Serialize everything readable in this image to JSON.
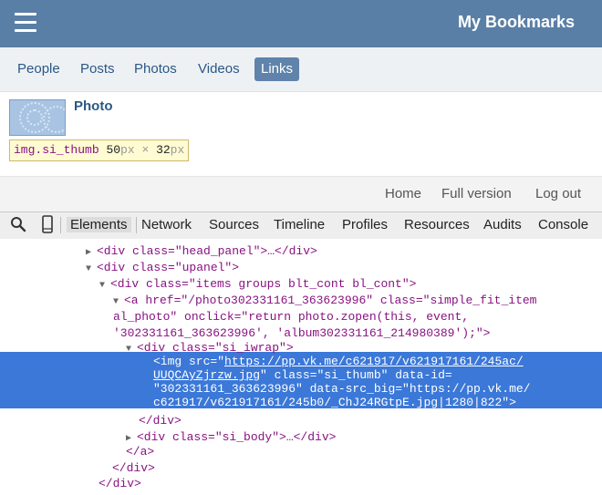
{
  "header": {
    "title": "My Bookmarks",
    "menu_icon": "hamburger-menu-icon"
  },
  "tabs": [
    {
      "label": "People",
      "active": false
    },
    {
      "label": "Posts",
      "active": false
    },
    {
      "label": "Photos",
      "active": false
    },
    {
      "label": "Videos",
      "active": false
    },
    {
      "label": "Links",
      "active": true
    }
  ],
  "content": {
    "item_title": "Photo",
    "tooltip": {
      "selector": "img.si_thumb",
      "width": "50",
      "unit1": "px",
      "times": " × ",
      "height": "32",
      "unit2": "px"
    }
  },
  "footer_links": [
    "Home",
    "Full version",
    "Log out"
  ],
  "devtools": {
    "icons": [
      "search-icon",
      "device-icon"
    ],
    "tabs": [
      "Elements",
      "Network",
      "Sources",
      "Timeline",
      "Profiles",
      "Resources",
      "Audits",
      "Console"
    ],
    "active_tab": "Elements"
  },
  "dom": {
    "l0": "<div class=\"head_panel\">…</div>",
    "l1": "<div class=\"upanel\">",
    "l2": "<div class=\"items groups blt_cont bl_cont\">",
    "l3a": "<a href=\"/photo302331161_363623996\" class=\"simple_fit_item",
    "l3b": "al_photo\" onclick=\"return photo.zopen(this, event,",
    "l3c": "'302331161_363623996', 'album302331161_214980389');\">",
    "l4": "<div class=\"si_iwrap\">",
    "l5a_pre": "<img src=\"",
    "l5a_url": "https://pp.vk.me/c621917/v621917161/245ac/",
    "l5b_url": "UUQCAyZjrzw.jpg",
    "l5b_post": "\" class=\"si_thumb\" data-id=",
    "l5c": "\"302331161_363623996\" data-src_big=\"https://pp.vk.me/",
    "l5d": "c621917/v621917161/245b0/_ChJ24RGtpE.jpg|1280|822\">",
    "l6": "</div>",
    "l7": "<div class=\"si_body\">…</div>",
    "l8": "</a>",
    "l9": "</div>",
    "l10": "</div>"
  }
}
